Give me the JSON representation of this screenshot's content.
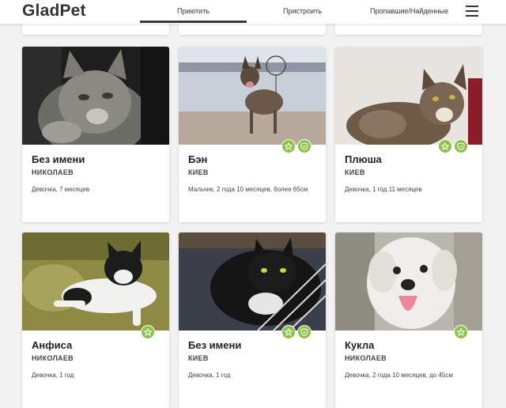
{
  "header": {
    "logo": "GladPet",
    "nav": {
      "adopt": "Приютить",
      "place": "Пристроить",
      "lost_found": "Пропавшие/Найденные"
    }
  },
  "pets": [
    {
      "name": "Без имени",
      "city": "НИКОЛАЕВ",
      "info": "Девочка, 7 месяцев"
    },
    {
      "name": "Бэн",
      "city": "КИЕВ",
      "info": "Мальчик, 2 года 10 месяцев, более 65см"
    },
    {
      "name": "Плюша",
      "city": "КИЕВ",
      "info": "Девочка, 1 год 11 месяцев"
    },
    {
      "name": "Анфиса",
      "city": "НИКОЛАЕВ",
      "info": "Девочка, 1 год"
    },
    {
      "name": "Без имени",
      "city": "КИЕВ",
      "info": "Девочка, 1 год"
    },
    {
      "name": "Кукла",
      "city": "НИКОЛАЕВ",
      "info": "Девочка, 2 года 10 месяцев, до 45см"
    }
  ],
  "icons": {
    "badge_star": "star-icon",
    "badge_verified": "shield-check-icon",
    "menu": "hamburger-menu-icon"
  },
  "colors": {
    "badge": "#8bc34a",
    "nav_active": "#3a3a3a"
  }
}
